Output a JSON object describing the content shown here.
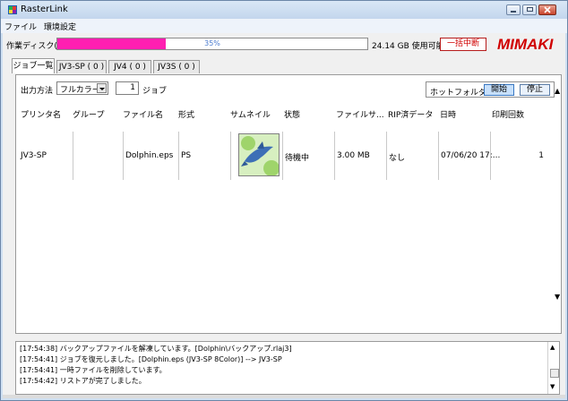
{
  "window": {
    "title": "RasterLink",
    "controls": [
      "minimize-icon",
      "maximize-icon",
      "close-icon"
    ]
  },
  "menubar": {
    "items": [
      "ファイル",
      "環境設定"
    ]
  },
  "disk": {
    "label": "作業ディスク(C:)",
    "percent_text": "35%",
    "percent_value": 0.35,
    "available": "24.14 GB 使用可能",
    "stop_all_label": "一括中断",
    "brand_logo_text": "MIMAKI",
    "accent_color": "#ff1fb1",
    "brand_color": "#d00000"
  },
  "tabs": [
    {
      "label": "ジョブ一覧"
    },
    {
      "label": "JV3-SP ( 0 )"
    },
    {
      "label": "JV4 ( 0 )"
    },
    {
      "label": "JV3S ( 0 )"
    }
  ],
  "toolbar": {
    "output_label": "出力方法",
    "output_value": "フルカラー",
    "job_count": "1",
    "job_unit": "ジョブ",
    "hot_folder_label": "ホットフォルダ",
    "start_label": "開始",
    "stop_label": "停止"
  },
  "table": {
    "headers": [
      "プリンタ名",
      "グループ",
      "ファイル名",
      "形式",
      "サムネイル",
      "状態",
      "ファイルサ...",
      "RIP済データ",
      "日時",
      "印刷回数"
    ],
    "rows": [
      {
        "printer": "JV3-SP",
        "group": "",
        "file": "Dolphin.eps",
        "format": "PS",
        "thumbnail": "dolphin-thumbnail",
        "status": "待機中",
        "size": "3.00 MB",
        "rip": "なし",
        "date": "07/06/20 17:...",
        "count": "1"
      }
    ]
  },
  "log": {
    "lines": [
      "[17:54:38] バックアップファイルを解凍しています。[Dolphin\\バックアップ.rlaj3]",
      "[17:54:41] ジョブを復元しました。[Dolphin.eps (JV3-SP 8Color)] --> JV3-SP",
      "[17:54:41] 一時ファイルを削除しています。",
      "[17:54:42] リストアが完了しました。"
    ]
  }
}
